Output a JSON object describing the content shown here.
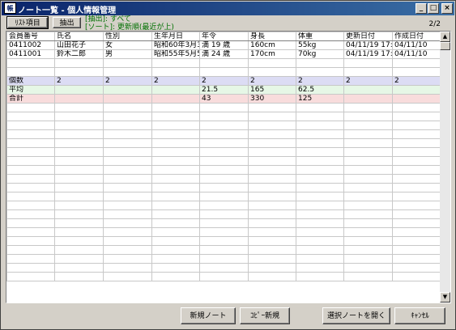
{
  "window": {
    "icon_text": "帳",
    "title": "ノート一覧 - 個人情報管理",
    "minimize": "_",
    "maximize": "□",
    "close": "×"
  },
  "toolbar": {
    "list_items_button": "ﾘｽﾄ項目",
    "filter_button": "抽出",
    "filter_info": "[抽出]: すべて",
    "sort_info": "[ソート]: 更新順(最近が上)",
    "page_count": "2/2"
  },
  "table": {
    "columns": [
      "会員番号",
      "氏名",
      "性別",
      "生年月日",
      "年令",
      "身長",
      "体重",
      "更新日付",
      "作成日付"
    ],
    "rows": [
      [
        "0411002",
        "山田花子",
        "女",
        "昭和60年3月3",
        "満 19 歳",
        "160cm",
        "55kg",
        "04/11/19 17:",
        "04/11/10"
      ],
      [
        "0411001",
        "鈴木二郎",
        "男",
        "昭和55年5月5",
        "満 24 歳",
        "170cm",
        "70kg",
        "04/11/19 17:",
        "04/11/10"
      ]
    ],
    "summary": {
      "count": [
        "個数",
        "2",
        "2",
        "2",
        "2",
        "2",
        "2",
        "2",
        "2"
      ],
      "average": [
        "平均",
        "",
        "",
        "",
        "21.5",
        "165",
        "62.5",
        "",
        ""
      ],
      "total": [
        "合計",
        "",
        "",
        "",
        "43",
        "330",
        "125",
        "",
        ""
      ]
    }
  },
  "scrollbar": {
    "up": "▲",
    "down": "▼"
  },
  "footer": {
    "new_note": "新規ノート",
    "copy_new": "ｺﾋﾟｰ新規",
    "open_selected": "選択ノートを開く",
    "cancel": "ｷｬﾝｾﾙ"
  }
}
